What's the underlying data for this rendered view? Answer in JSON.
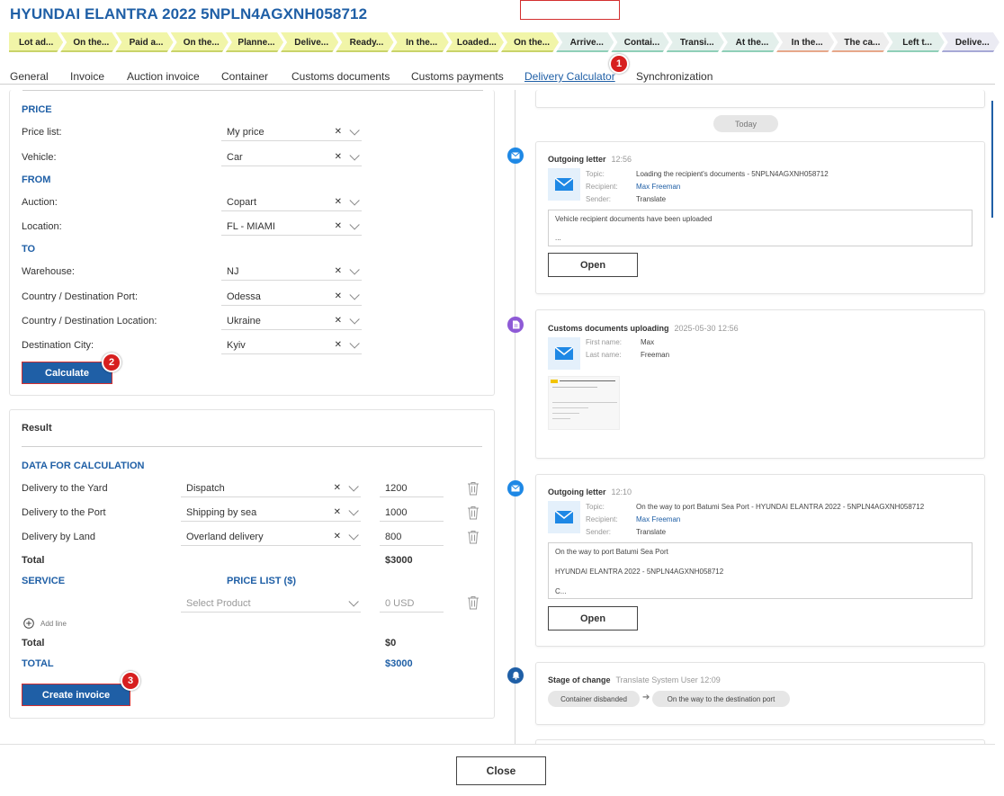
{
  "header": {
    "title": "HYUNDAI ELANTRA 2022 5NPLN4AGXNH058712"
  },
  "stages": [
    {
      "label": "Lot ad...",
      "bg": "#f1f5a8",
      "line": "#c9d36a"
    },
    {
      "label": "On the...",
      "bg": "#f1f5a8",
      "line": "#c9d36a"
    },
    {
      "label": "Paid a...",
      "bg": "#f1f5a8",
      "line": "#c9d36a"
    },
    {
      "label": "On the...",
      "bg": "#f1f5a8",
      "line": "#c9d36a"
    },
    {
      "label": "Planne...",
      "bg": "#f1f5a8",
      "line": "#c9d36a"
    },
    {
      "label": "Delive...",
      "bg": "#f1f5a8",
      "line": "#c9d36a"
    },
    {
      "label": "Ready...",
      "bg": "#f1f5a8",
      "line": "#c9d36a"
    },
    {
      "label": "In the...",
      "bg": "#f1f5a8",
      "line": "#c9d36a"
    },
    {
      "label": "Loaded...",
      "bg": "#f1f5a8",
      "line": "#c9d36a"
    },
    {
      "label": "On the...",
      "bg": "#f1f5a8",
      "line": "#c9d36a"
    },
    {
      "label": "Arrive...",
      "bg": "#e3efeb",
      "line": "#8fcfb8"
    },
    {
      "label": "Contai...",
      "bg": "#e3efeb",
      "line": "#8fcfb8"
    },
    {
      "label": "Transi...",
      "bg": "#e3efeb",
      "line": "#8fcfb8"
    },
    {
      "label": "At the...",
      "bg": "#e3efeb",
      "line": "#8fcfb8"
    },
    {
      "label": "In the...",
      "bg": "#eeeeee",
      "line": "#e7a88a"
    },
    {
      "label": "The ca...",
      "bg": "#eeeeee",
      "line": "#e7a88a"
    },
    {
      "label": "Left t...",
      "bg": "#e3efeb",
      "line": "#8fcfb8"
    },
    {
      "label": "Delive...",
      "bg": "#ebebf3",
      "line": "#a7a9d6"
    }
  ],
  "tabs": [
    "General",
    "Invoice",
    "Auction invoice",
    "Container",
    "Customs documents",
    "Customs payments",
    "Delivery Calculator",
    "Synchronization"
  ],
  "badges": [
    "1",
    "2",
    "3"
  ],
  "form": {
    "price_section": "PRICE",
    "price_list_label": "Price list:",
    "price_list_value": "My price",
    "vehicle_label": "Vehicle:",
    "vehicle_value": "Car",
    "from_section": "FROM",
    "auction_label": "Auction:",
    "auction_value": "Copart",
    "location_label": "Location:",
    "location_value": "FL - MIAMI",
    "to_section": "TO",
    "warehouse_label": "Warehouse:",
    "warehouse_value": "NJ",
    "dest_port_label": "Country / Destination Port:",
    "dest_port_value": "Odessa",
    "dest_loc_label": "Country / Destination Location:",
    "dest_loc_value": "Ukraine",
    "dest_city_label": "Destination City:",
    "dest_city_value": "Kyiv",
    "calculate_label": "Calculate"
  },
  "result": {
    "title": "Result",
    "data_section": "DATA FOR CALCULATION",
    "rows": [
      {
        "label": "Delivery to the Yard",
        "method": "Dispatch",
        "amount": "1200"
      },
      {
        "label": "Delivery to the Port",
        "method": "Shipping by sea",
        "amount": "1000"
      },
      {
        "label": "Delivery by Land",
        "method": "Overland delivery",
        "amount": "800"
      }
    ],
    "total_label": "Total",
    "total_value": "$3000",
    "service_section": "SERVICE",
    "price_list_section": "PRICE LIST ($)",
    "product_placeholder": "Select Product",
    "usd_placeholder": "0 USD",
    "add_line_label": "Add line",
    "service_total_label": "Total",
    "service_total_value": "$0",
    "grand_total_label": "TOTAL",
    "grand_total_value": "$3000",
    "create_invoice_label": "Create invoice"
  },
  "timeline": {
    "today_label": "Today",
    "cards": [
      {
        "title": "Outgoing letter",
        "time": "12:56",
        "topic_label": "Topic:",
        "topic": "Loading the recipient's documents - 5NPLN4AGXNH058712",
        "recipient_label": "Recipient:",
        "recipient": "Max Freeman",
        "sender_label": "Sender:",
        "sender": "Translate",
        "message_line1": "Vehicle recipient documents have been uploaded",
        "message_line2": "...",
        "open_label": "Open"
      },
      {
        "title": "Customs documents uploading",
        "time": "2025-05-30 12:56",
        "first_name_label": "First name:",
        "first_name": "Max",
        "last_name_label": "Last name:",
        "last_name": "Freeman"
      },
      {
        "title": "Outgoing letter",
        "time": "12:10",
        "topic_label": "Topic:",
        "topic": "On the way to port Batumi Sea Port - HYUNDAI ELANTRA 2022 - 5NPLN4AGXNH058712",
        "recipient_label": "Recipient:",
        "recipient": "Max Freeman",
        "sender_label": "Sender:",
        "sender": "Translate",
        "message_line1": "On the way to port Batumi Sea Port",
        "message_line2": "HYUNDAI ELANTRA 2022 - 5NPLN4AGXNH058712",
        "message_line3": "C...",
        "open_label": "Open"
      },
      {
        "title": "Stage of change",
        "time": "Translate System User 12:09",
        "from_stage": "Container disbanded",
        "to_stage": "On the way to the destination port"
      }
    ]
  },
  "footer": {
    "close_label": "Close"
  },
  "colors": {
    "accent": "#1f5fa6",
    "annotation_red": "#d71f1f",
    "mail_dot": "#1e88e5",
    "doc_dot": "#8e5ad6",
    "stage_dot": "#1f5fa6"
  },
  "icons": [
    "mail-icon",
    "document-icon",
    "bell-icon",
    "trash-icon",
    "chevron-down-icon",
    "clear-icon",
    "plus-circle-icon",
    "arrow-right-icon"
  ]
}
